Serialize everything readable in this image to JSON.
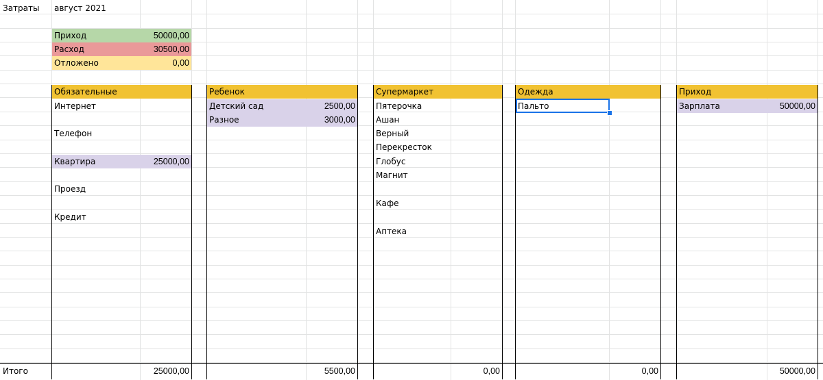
{
  "title": {
    "label": "Затраты",
    "period": "август 2021"
  },
  "colors": {
    "income_green": "#b6d7a8",
    "expense_red": "#ea9999",
    "saved_yellow": "#ffe599",
    "header_amber": "#f1c232",
    "highlight_lavender": "#d9d2e9",
    "selection_blue": "#1a73e8"
  },
  "summary": [
    {
      "label": "Приход",
      "value": "50000,00"
    },
    {
      "label": "Расход",
      "value": "30500,00"
    },
    {
      "label": "Отложено",
      "value": "0,00"
    }
  ],
  "categories": {
    "obligatory": {
      "title": "Обязательные",
      "items": [
        "Интернет",
        "Телефон",
        "Квартира",
        "Проезд",
        "Кредит"
      ],
      "amounts": {
        "Квартира": "25000,00"
      },
      "total": "25000,00"
    },
    "child": {
      "title": "Ребенок",
      "items": [
        "Детский сад",
        "Разное"
      ],
      "amounts": [
        "2500,00",
        "3000,00"
      ],
      "total": "5500,00"
    },
    "supermarket": {
      "title": "Супермаркет",
      "items": [
        "Пятерочка",
        "Ашан",
        "Верный",
        "Перекресток",
        "Глобус",
        "Магнит",
        "Кафе",
        "Аптека"
      ],
      "total": "0,00"
    },
    "clothes": {
      "title": "Одежда",
      "items": [
        "Пальто"
      ],
      "total": "0,00"
    },
    "income": {
      "title": "Приход",
      "items": [
        "Зарплата"
      ],
      "amounts": [
        "50000,00"
      ],
      "total": "50000,00"
    }
  },
  "footer": {
    "total_label": "Итого"
  }
}
